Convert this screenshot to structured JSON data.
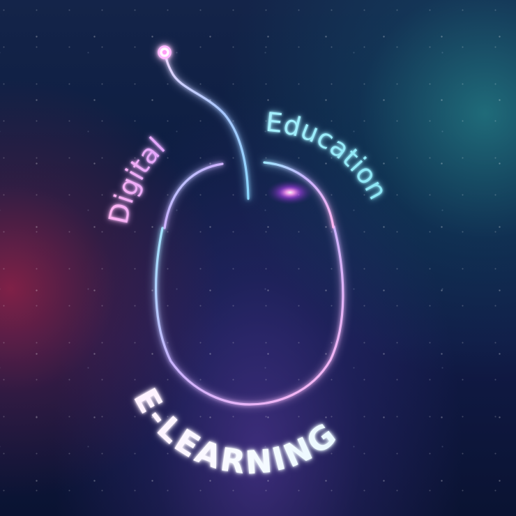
{
  "hero": {
    "left_arc_text": "Digital",
    "right_arc_text": "Education",
    "bottom_arc_text": "E-LEARNING"
  },
  "icons": {
    "main_icon": "computer-mouse-icon",
    "cable_endpoint": "glowing-dot-icon"
  },
  "colors": {
    "pink": "#ff9ee8",
    "lavender": "#d6b7ff",
    "cyan": "#8de9f7",
    "blue": "#7fa8ff",
    "white_glow": "#f7f3ff",
    "highlight": "#ff4fd8"
  }
}
